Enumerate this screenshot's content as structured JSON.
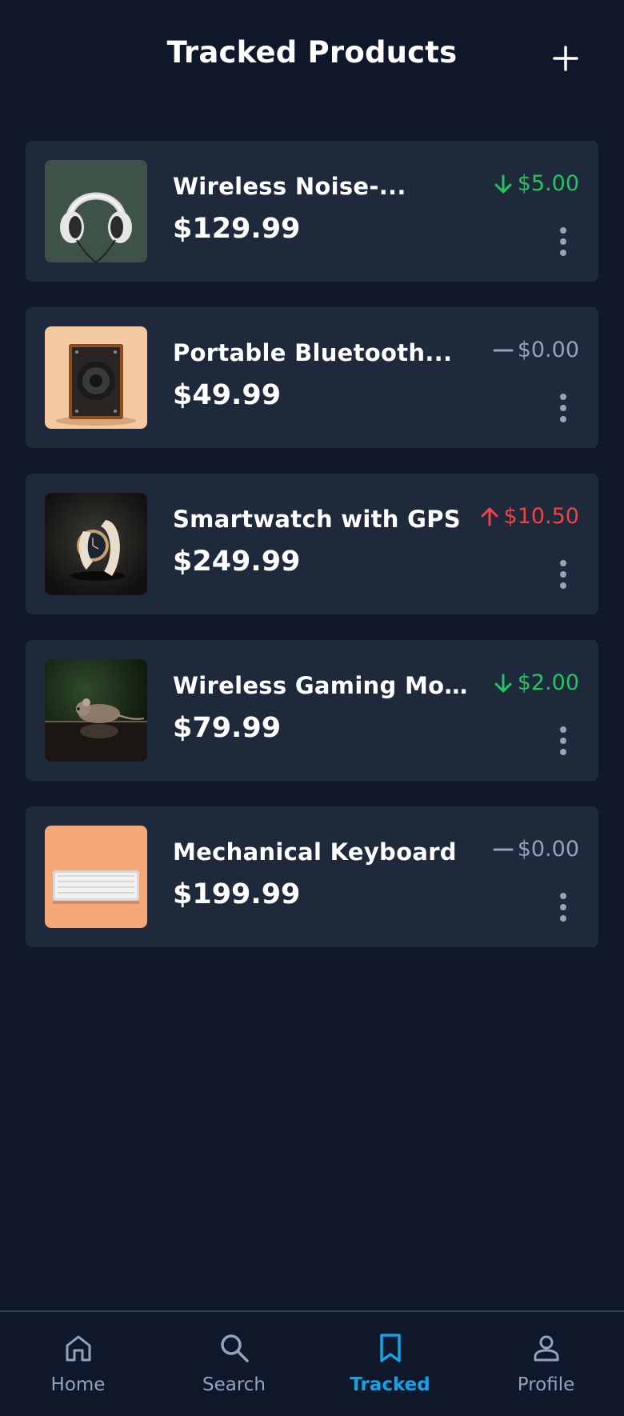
{
  "header": {
    "title": "Tracked Products",
    "add_icon": "plus-icon"
  },
  "colors": {
    "background": "#0f172a",
    "card": "#1e293b",
    "down": "#22c55e",
    "up": "#ef4444",
    "flat": "#94a3b8",
    "accent": "#0ea5e9"
  },
  "products": [
    {
      "name": "Wireless Noise-...",
      "price": "$129.99",
      "change": "$5.00",
      "trend": "down",
      "image": "headphones"
    },
    {
      "name": "Portable Bluetooth...",
      "price": "$49.99",
      "change": "$0.00",
      "trend": "flat",
      "image": "speaker"
    },
    {
      "name": "Smartwatch with GPS",
      "price": "$249.99",
      "change": "$10.50",
      "trend": "up",
      "image": "smartwatch"
    },
    {
      "name": "Wireless Gaming Mouse",
      "price": "$79.99",
      "change": "$2.00",
      "trend": "down",
      "image": "mouse"
    },
    {
      "name": "Mechanical Keyboard",
      "price": "$199.99",
      "change": "$0.00",
      "trend": "flat",
      "image": "keyboard"
    }
  ],
  "nav": {
    "items": [
      {
        "label": "Home",
        "icon": "home-icon",
        "active": false
      },
      {
        "label": "Search",
        "icon": "search-icon",
        "active": false
      },
      {
        "label": "Tracked",
        "icon": "bookmark-icon",
        "active": true
      },
      {
        "label": "Profile",
        "icon": "user-icon",
        "active": false
      }
    ]
  }
}
